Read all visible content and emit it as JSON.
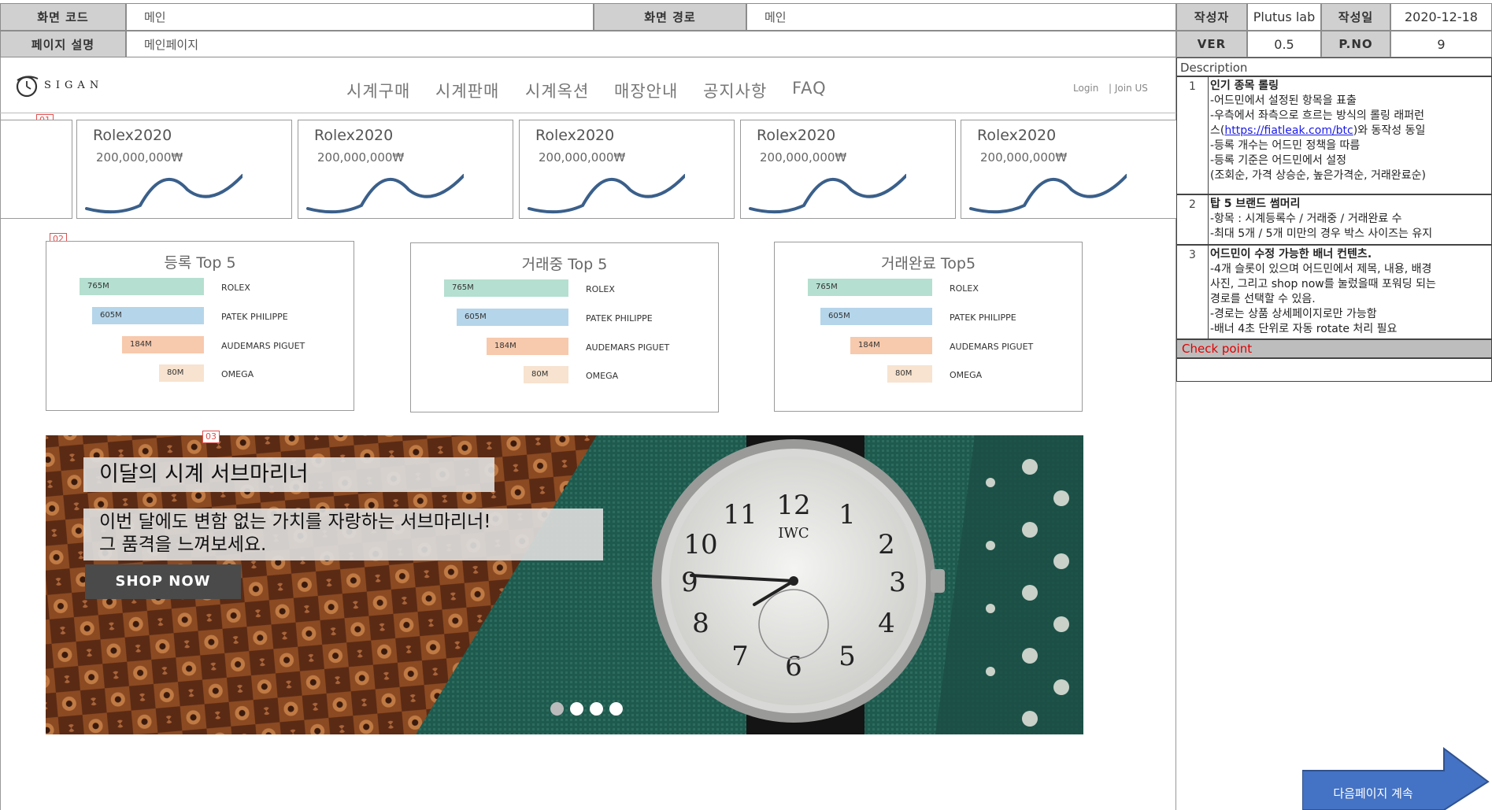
{
  "header": {
    "screen_code_label": "화면 코드",
    "screen_code_value": "메인",
    "screen_path_label": "화면 경로",
    "screen_path_value": "메인",
    "page_desc_label": "페이지 설명",
    "page_desc_value": "메인페이지",
    "author_label": "작성자",
    "author_value": "Plutus lab",
    "date_label": "작성일",
    "date_value": "2020-12-18",
    "ver_label": "VER",
    "ver_value": "0.5",
    "pno_label": "P.NO",
    "pno_value": "9"
  },
  "site": {
    "logo_text": "SIGAN",
    "nav": [
      "시계구매",
      "시계판매",
      "시계옥션",
      "매장안내",
      "공지사항",
      "FAQ"
    ],
    "login": "Login",
    "join": "| Join US"
  },
  "markers": {
    "m1": "01",
    "m2": "02",
    "m3": "03"
  },
  "ticker": {
    "cards": [
      {
        "name": "Rolex2020",
        "price": "200,000,000₩"
      },
      {
        "name": "Rolex2020",
        "price": "200,000,000₩"
      },
      {
        "name": "Rolex2020",
        "price": "200,000,000₩"
      },
      {
        "name": "Rolex2020",
        "price": "200,000,000₩"
      },
      {
        "name": "Rolex2020",
        "price": "200,000,000₩"
      }
    ],
    "line_color": "#3a5f8a"
  },
  "top5": [
    {
      "title": "등록 Top 5"
    },
    {
      "title": "거래중 Top 5"
    },
    {
      "title": "거래완료 Top5"
    }
  ],
  "chart_data": {
    "type": "bar",
    "categories": [
      "ROLEX",
      "PATEK PHILIPPE",
      "AUDEMARS PIGUET",
      "OMEGA"
    ],
    "value_labels": [
      "765M",
      "605M",
      "184M",
      "80M"
    ],
    "colors": [
      "#b5dfd0",
      "#b5d5ea",
      "#f7c9ad",
      "#f7e3cf"
    ]
  },
  "banner": {
    "title": "이달의 시계 서브마리너",
    "line1": "이번 달에도 변함 없는 가치를 자랑하는 서브마리너!",
    "line2": "그 품격을 느껴보세요.",
    "button": "SHOP NOW",
    "dots": 4,
    "active_dot": 0
  },
  "description": {
    "header": "Description",
    "items": [
      {
        "num": "1",
        "title": "인기 종목 롤링",
        "lines": [
          "-어드민에서 설정된 항목을 표출",
          "-우측에서 좌측으로 흐르는 방식의 롤링 래퍼런",
          "스(",
          "https://fiatleak.com/btc",
          ")와 동작성 동일",
          "-등록 개수는 어드민 정책을 따름",
          "-등록 기준은 어드민에서 설정",
          "(조회순, 가격 상승순, 높은가격순, 거래완료순)"
        ]
      },
      {
        "num": "2",
        "title": "탑 5 브랜드 썸머리",
        "lines": [
          "-항목 : 시계등록수 / 거래중 / 거래완료 수",
          "-최대 5개 / 5개 미만의 경우 박스 사이즈는 유지"
        ]
      },
      {
        "num": "3",
        "title": "어드민이 수정 가능한 배너 컨텐츠.",
        "lines": [
          "-4개 슬롯이 있으며 어드민에서 제목, 내용, 배경",
          "사진, 그리고 shop now를 눌렀을때 포워딩 되는",
          "경로를 선택할 수 있음.",
          "-경로는 상품 상세페이지로만 가능함",
          "-배너 4초 단위로 자동 rotate 처리 필요"
        ]
      }
    ],
    "checkpoint": "Check point",
    "next_page": "다음페이지 계속"
  }
}
